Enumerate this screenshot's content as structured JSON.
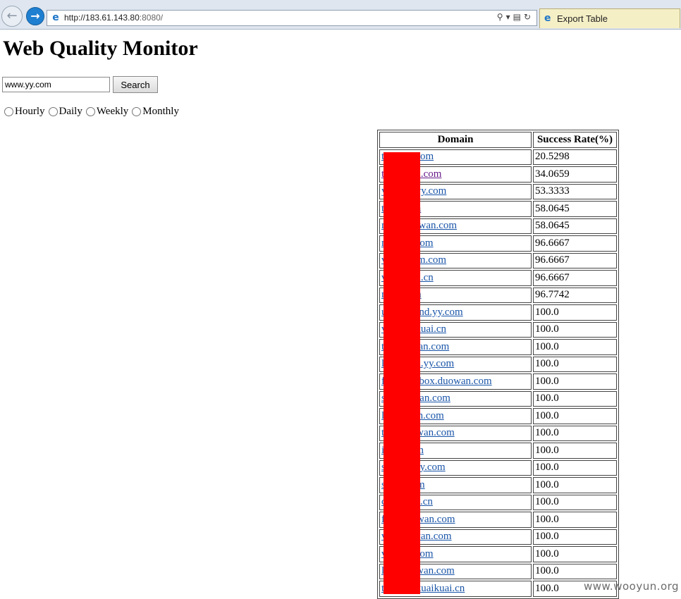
{
  "browser": {
    "url_host": "http://183.61.143.80",
    "url_rest": ":8080/",
    "tab_title": "Export Table"
  },
  "page": {
    "title": "Web Quality Monitor",
    "search": {
      "value": "www.yy.com",
      "button_label": "Search"
    },
    "periods": [
      "Hourly",
      "Daily",
      "Weekly",
      "Monthly"
    ]
  },
  "table": {
    "headers": [
      "Domain",
      "Success Rate(%)"
    ],
    "rows": [
      {
        "domain": "t       an.com",
        "rate": "20.5298",
        "visited": false
      },
      {
        "domain": "t        van.com",
        "rate": "34.0659",
        "visited": true
      },
      {
        "domain": "y        g.yy.com",
        "rate": "53.3333",
        "visited": false
      },
      {
        "domain": "t       com",
        "rate": "58.0645",
        "visited": false
      },
      {
        "domain": "n        uowan.com",
        "rate": "58.0645",
        "visited": false
      },
      {
        "domain": "n        y.com",
        "rate": "96.6667",
        "visited": false
      },
      {
        "domain": "v        ysm.com",
        "rate": "96.6667",
        "visited": false
      },
      {
        "domain": "v        uai.cn",
        "rate": "96.6667",
        "visited": false
      },
      {
        "domain": "n        om",
        "rate": "96.7742",
        "visited": false
      },
      {
        "domain": "u        riend.yy.com",
        "rate": "100.0",
        "visited": false
      },
      {
        "domain": "v        aikuai.cn",
        "rate": "100.0",
        "visited": false
      },
      {
        "domain": "t        owan.com",
        "rate": "100.0",
        "visited": false
      },
      {
        "domain": "l        bed.yy.com",
        "rate": "100.0",
        "visited": false
      },
      {
        "domain": "f        mebox.duowan.com",
        "rate": "100.0",
        "visited": false
      },
      {
        "domain": "s        owan.com",
        "rate": "100.0",
        "visited": false
      },
      {
        "domain": "l        wan.com",
        "rate": "100.0",
        "visited": false
      },
      {
        "domain": "t        uowan.com",
        "rate": "100.0",
        "visited": false
      },
      {
        "domain": "i        com",
        "rate": "100.0",
        "visited": false
      },
      {
        "domain": "s        n.yy.com",
        "rate": "100.0",
        "visited": false
      },
      {
        "domain": "s        com",
        "rate": "100.0",
        "visited": false
      },
      {
        "domain": "c        uai.cn",
        "rate": "100.0",
        "visited": false
      },
      {
        "domain": "f        uowan.com",
        "rate": "100.0",
        "visited": false
      },
      {
        "domain": "v        owan.com",
        "rate": "100.0",
        "visited": false
      },
      {
        "domain": "v        y.com",
        "rate": "100.0",
        "visited": false
      },
      {
        "domain": "l        uowan.com",
        "rate": "100.0",
        "visited": false
      },
      {
        "domain": "t        er.kuaikuai.cn",
        "rate": "100.0",
        "visited": false
      }
    ]
  },
  "watermark": "www.wooyun.org",
  "colors": {
    "redaction": "#ff0000",
    "link": "#1a55a8",
    "visited_link": "#6a1b8a"
  }
}
